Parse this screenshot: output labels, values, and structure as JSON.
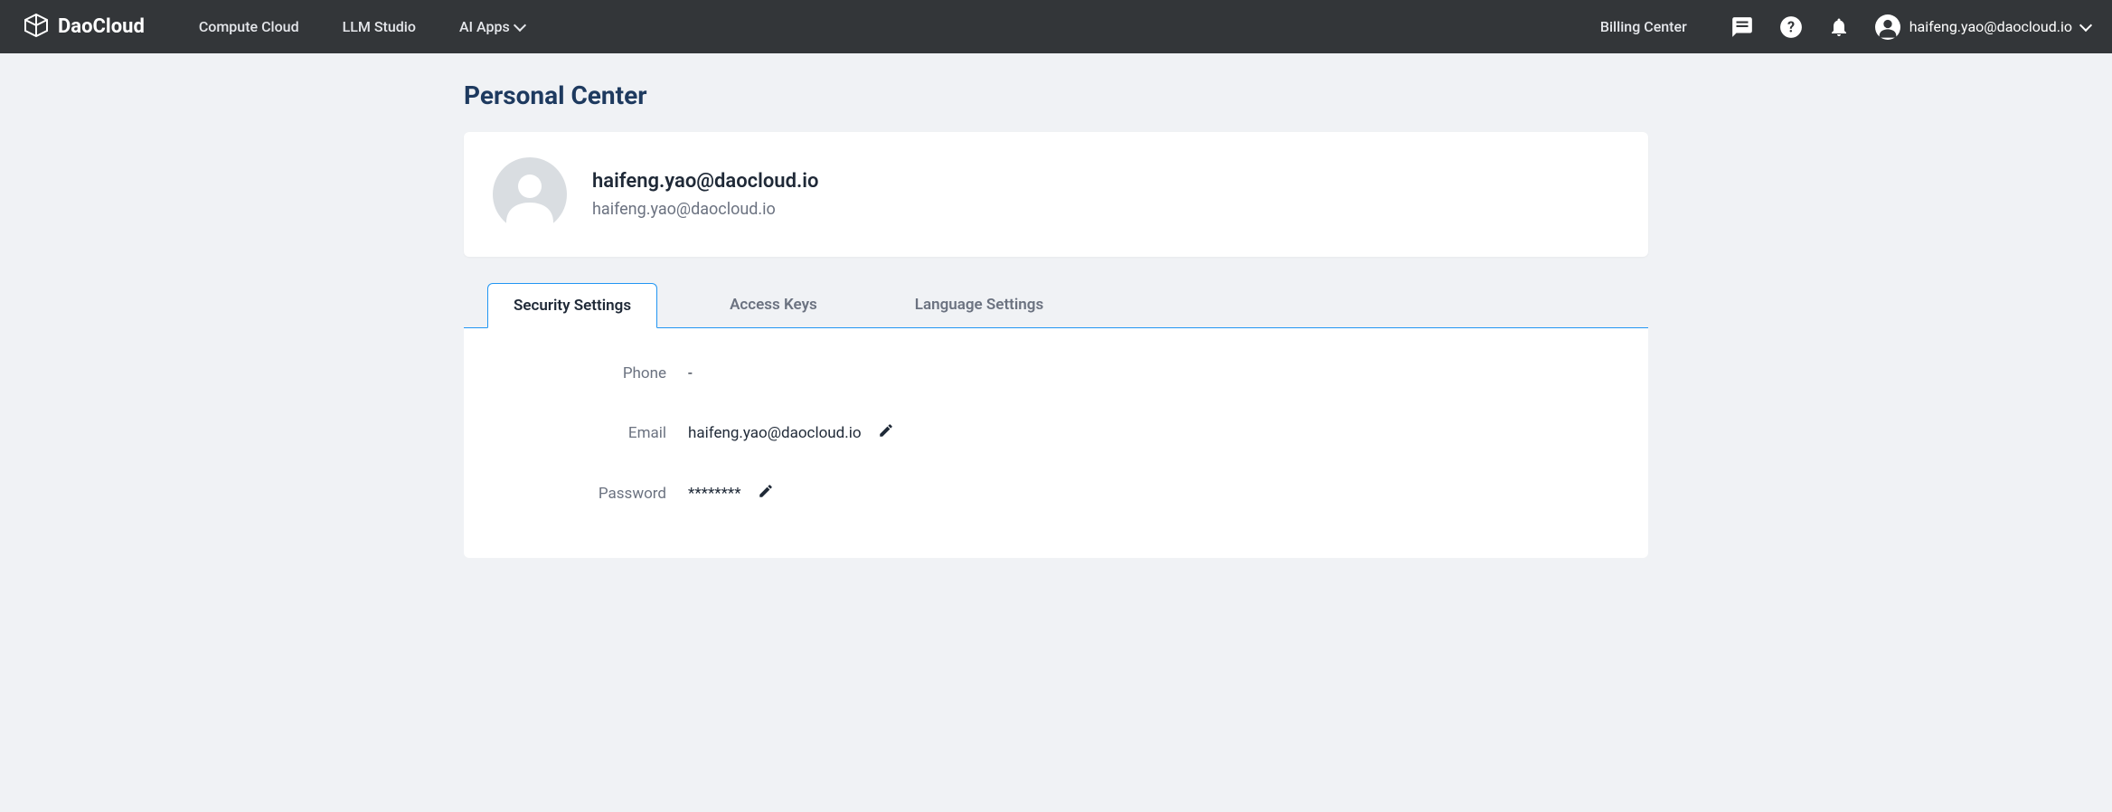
{
  "header": {
    "brand": "DaoCloud",
    "nav": {
      "compute": "Compute Cloud",
      "llm": "LLM Studio",
      "aiapps": "AI Apps"
    },
    "billing": "Billing Center",
    "user_email": "haifeng.yao@daocloud.io"
  },
  "page": {
    "title": "Personal Center"
  },
  "profile": {
    "display_name": "haifeng.yao@daocloud.io",
    "email": "haifeng.yao@daocloud.io"
  },
  "tabs": {
    "security": "Security Settings",
    "access_keys": "Access Keys",
    "language": "Language Settings"
  },
  "security": {
    "phone_label": "Phone",
    "phone_value": "-",
    "email_label": "Email",
    "email_value": "haifeng.yao@daocloud.io",
    "password_label": "Password",
    "password_value": "********"
  }
}
